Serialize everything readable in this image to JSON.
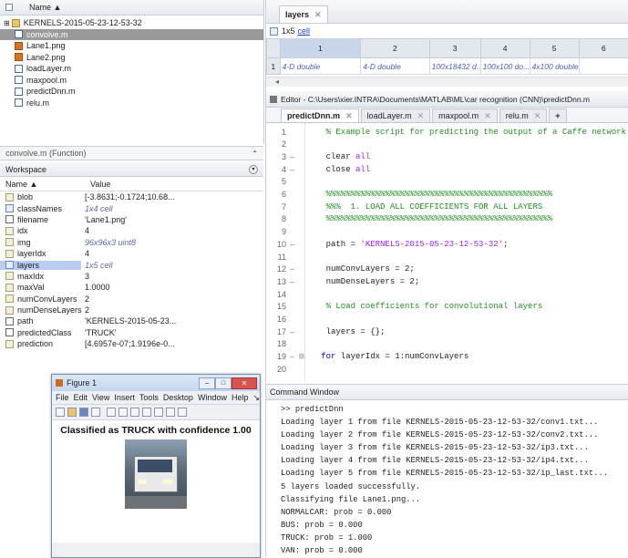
{
  "file_browser": {
    "column_name": "Name ▲",
    "folder": "KERNELS-2015-05-23-12-53-32",
    "files": [
      {
        "name": "convolve.m",
        "icon": "m",
        "selected": true
      },
      {
        "name": "Lane1.png",
        "icon": "png"
      },
      {
        "name": "Lane2.png",
        "icon": "png"
      },
      {
        "name": "loadLayer.m",
        "icon": "m"
      },
      {
        "name": "maxpool.m",
        "icon": "m"
      },
      {
        "name": "predictDnn.m",
        "icon": "m"
      },
      {
        "name": "relu.m",
        "icon": "m"
      }
    ],
    "details_label": "convolve.m (Function)"
  },
  "workspace": {
    "title": "Workspace",
    "col_name": "Name ▲",
    "col_value": "Value",
    "rows": [
      {
        "name": "blob",
        "value": "[-3.8631;-0.1724;10.68...",
        "icon": "var"
      },
      {
        "name": "classNames",
        "value": "1x4 cell",
        "icon": "cell",
        "italic": true
      },
      {
        "name": "filename",
        "value": "'Lane1.png'",
        "icon": "char"
      },
      {
        "name": "idx",
        "value": "4",
        "icon": "var"
      },
      {
        "name": "img",
        "value": "96x96x3 uint8",
        "icon": "var",
        "italic": true
      },
      {
        "name": "layerIdx",
        "value": "4",
        "icon": "var"
      },
      {
        "name": "layers",
        "value": "1x5 cell",
        "icon": "cell",
        "italic": true,
        "selected": true
      },
      {
        "name": "maxIdx",
        "value": "3",
        "icon": "var"
      },
      {
        "name": "maxVal",
        "value": "1.0000",
        "icon": "var"
      },
      {
        "name": "numConvLayers",
        "value": "2",
        "icon": "var"
      },
      {
        "name": "numDenseLayers",
        "value": "2",
        "icon": "var"
      },
      {
        "name": "path",
        "value": "'KERNELS-2015-05-23...",
        "icon": "char"
      },
      {
        "name": "predictedClass",
        "value": "'TRUCK'",
        "icon": "char"
      },
      {
        "name": "prediction",
        "value": "[4.6957e-07;1.9196e-0...",
        "icon": "var"
      }
    ]
  },
  "figure": {
    "title": "Figure 1",
    "menu": [
      "File",
      "Edit",
      "View",
      "Insert",
      "Tools",
      "Desktop",
      "Window",
      "Help"
    ],
    "caption": "Classified as TRUCK with confidence 1.00"
  },
  "variable_editor": {
    "tab": "layers",
    "crumb": "1x5",
    "crumb_link": "cell",
    "col_headers": [
      "1",
      "2",
      "3",
      "4",
      "5",
      "6"
    ],
    "row_header": "1",
    "cells": [
      "4-D double",
      "4-D double",
      "100x18432 d...",
      "100x100 do...",
      "4x100 double",
      ""
    ]
  },
  "editor": {
    "title": "Editor - C:\\Users\\xier.INTRA\\Documents\\MATLAB\\ML\\car recognition (CNN)\\predictDnn.m",
    "tabs": [
      "predictDnn.m",
      "loadLayer.m",
      "maxpool.m",
      "relu.m"
    ],
    "lines": [
      {
        "n": "1",
        "parts": [
          {
            "t": "    % Example script for predicting the output of a Caffe network",
            "c": "cmt"
          }
        ]
      },
      {
        "n": "2",
        "parts": []
      },
      {
        "n": "3",
        "dash": true,
        "parts": [
          {
            "t": "    clear ",
            "c": ""
          },
          {
            "t": "all",
            "c": "str"
          }
        ]
      },
      {
        "n": "4",
        "dash": true,
        "parts": [
          {
            "t": "    close ",
            "c": ""
          },
          {
            "t": "all",
            "c": "str"
          }
        ]
      },
      {
        "n": "5",
        "parts": []
      },
      {
        "n": "6",
        "parts": [
          {
            "t": "    %%%%%%%%%%%%%%%%%%%%%%%%%%%%%%%%%%%%%%%%%%%%%%",
            "c": "cmt"
          }
        ]
      },
      {
        "n": "7",
        "parts": [
          {
            "t": "    %%%  1. LOAD ALL COEFFICIENTS FOR ALL LAYERS",
            "c": "cmt"
          }
        ]
      },
      {
        "n": "8",
        "parts": [
          {
            "t": "    %%%%%%%%%%%%%%%%%%%%%%%%%%%%%%%%%%%%%%%%%%%%%%",
            "c": "cmt"
          }
        ]
      },
      {
        "n": "9",
        "parts": []
      },
      {
        "n": "10",
        "dash": true,
        "parts": [
          {
            "t": "    path = ",
            "c": ""
          },
          {
            "t": "'KERNELS-2015-05-23-12-53-32'",
            "c": "str"
          },
          {
            "t": ";",
            "c": ""
          }
        ]
      },
      {
        "n": "11",
        "parts": []
      },
      {
        "n": "12",
        "dash": true,
        "parts": [
          {
            "t": "    numConvLayers = 2;",
            "c": ""
          }
        ]
      },
      {
        "n": "13",
        "dash": true,
        "parts": [
          {
            "t": "    numDenseLayers = 2;",
            "c": ""
          }
        ]
      },
      {
        "n": "14",
        "parts": []
      },
      {
        "n": "15",
        "parts": [
          {
            "t": "    % Load coefficients for convolutional layers",
            "c": "cmt"
          }
        ]
      },
      {
        "n": "16",
        "parts": []
      },
      {
        "n": "17",
        "dash": true,
        "parts": [
          {
            "t": "    layers = {};",
            "c": ""
          }
        ]
      },
      {
        "n": "18",
        "parts": []
      },
      {
        "n": "19",
        "dash": true,
        "fold": true,
        "parts": [
          {
            "t": "   ",
            "c": ""
          },
          {
            "t": "for",
            "c": "kw"
          },
          {
            "t": " layerIdx = 1:numConvLayers",
            "c": ""
          }
        ]
      },
      {
        "n": "20",
        "parts": []
      }
    ]
  },
  "command_window": {
    "title": "Command Window",
    "lines": [
      ">> predictDnn",
      "Loading layer 1 from file KERNELS-2015-05-23-12-53-32/conv1.txt...",
      "Loading layer 2 from file KERNELS-2015-05-23-12-53-32/conv2.txt...",
      "Loading layer 3 from file KERNELS-2015-05-23-12-53-32/ip3.txt...",
      "Loading layer 4 from file KERNELS-2015-05-23-12-53-32/ip4.txt...",
      "Loading layer 5 from file KERNELS-2015-05-23-12-53-32/ip_last.txt...",
      "5 layers loaded successfully.",
      "Classifying file Lane1.png...",
      "NORMALCAR: prob = 0.000",
      "BUS: prob = 0.000",
      "TRUCK: prob = 1.000",
      "VAN: prob = 0.000"
    ]
  }
}
